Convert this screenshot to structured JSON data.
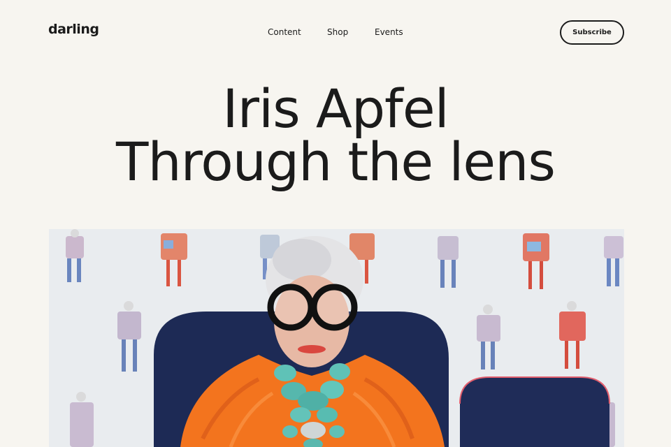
{
  "header": {
    "logo": "darling",
    "nav": [
      "Content",
      "Shop",
      "Events"
    ],
    "subscribe_label": "Subscribe"
  },
  "hero": {
    "title_line1": "Iris Apfel",
    "title_line2": "Through the lens"
  },
  "colors": {
    "background": "#f7f5f0",
    "text": "#1b1b1b",
    "coat_orange": "#f3741e",
    "chair_navy": "#1d2a55",
    "necklace_turquoise": "#5fc2b7"
  }
}
